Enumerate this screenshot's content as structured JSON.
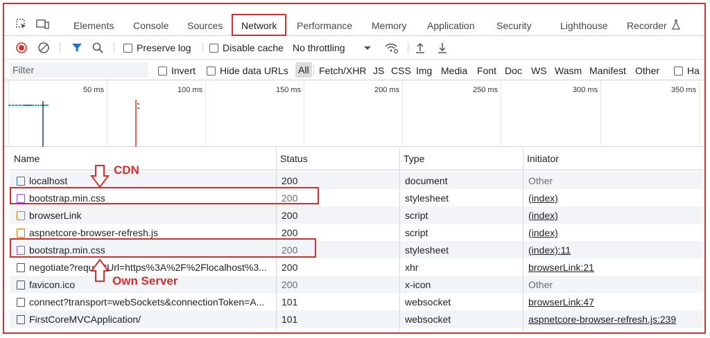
{
  "tabs": [
    {
      "label": "Elements"
    },
    {
      "label": "Console"
    },
    {
      "label": "Sources"
    },
    {
      "label": "Network",
      "active": true
    },
    {
      "label": "Performance"
    },
    {
      "label": "Memory"
    },
    {
      "label": "Application"
    },
    {
      "label": "Security"
    },
    {
      "label": "Lighthouse"
    },
    {
      "label": "Recorder"
    }
  ],
  "toolbar": {
    "preserve_log": "Preserve log",
    "disable_cache": "Disable cache",
    "throttling": "No throttling"
  },
  "filter": {
    "placeholder": "Filter",
    "invert": "Invert",
    "hide_data_urls": "Hide data URLs",
    "types": [
      "All",
      "Fetch/XHR",
      "JS",
      "CSS",
      "Img",
      "Media",
      "Font",
      "Doc",
      "WS",
      "Wasm",
      "Manifest",
      "Other"
    ],
    "has_blocked_truncated": "Ha"
  },
  "timeline": {
    "ticks": [
      "50 ms",
      "100 ms",
      "150 ms",
      "200 ms",
      "250 ms",
      "300 ms",
      "350 ms"
    ]
  },
  "table": {
    "headers": {
      "name": "Name",
      "status": "Status",
      "type": "Type",
      "initiator": "Initiator"
    },
    "rows": [
      {
        "icon": "doc",
        "name": "localhost",
        "status": "200",
        "status_grey": false,
        "type": "document",
        "initiator": "Other",
        "initiator_link": false
      },
      {
        "icon": "css",
        "name": "bootstrap.min.css",
        "status": "200",
        "status_grey": true,
        "type": "stylesheet",
        "initiator": "(index)",
        "initiator_link": true
      },
      {
        "icon": "js",
        "name": "browserLink",
        "status": "200",
        "status_grey": false,
        "type": "script",
        "initiator": "(index)",
        "initiator_link": true
      },
      {
        "icon": "js",
        "name": "aspnetcore-browser-refresh.js",
        "status": "200",
        "status_grey": false,
        "type": "script",
        "initiator": "(index)",
        "initiator_link": true
      },
      {
        "icon": "css",
        "name": "bootstrap.min.css",
        "status": "200",
        "status_grey": true,
        "type": "stylesheet",
        "initiator": "(index):11",
        "initiator_link": true
      },
      {
        "icon": "plain",
        "name": "negotiate?requestUrl=https%3A%2F%2Flocalhost%3...",
        "status": "200",
        "status_grey": false,
        "type": "xhr",
        "initiator": "browserLink:21",
        "initiator_link": true
      },
      {
        "icon": "plain",
        "name": "favicon.ico",
        "status": "200",
        "status_grey": true,
        "type": "x-icon",
        "initiator": "Other",
        "initiator_link": false
      },
      {
        "icon": "plain",
        "name": "connect?transport=webSockets&connectionToken=A...",
        "status": "101",
        "status_grey": false,
        "type": "websocket",
        "initiator": "browserLink:47",
        "initiator_link": true
      },
      {
        "icon": "plain",
        "name": "FirstCoreMVCApplication/",
        "status": "101",
        "status_grey": false,
        "type": "websocket",
        "initiator": "aspnetcore-browser-refresh.js:239",
        "initiator_link": true
      }
    ]
  },
  "annotations": {
    "cdn": "CDN",
    "own_server": "Own Server"
  },
  "colors": {
    "highlight": "#d32f2f",
    "record": "#d93025",
    "filter_active": "#1a73e8"
  }
}
